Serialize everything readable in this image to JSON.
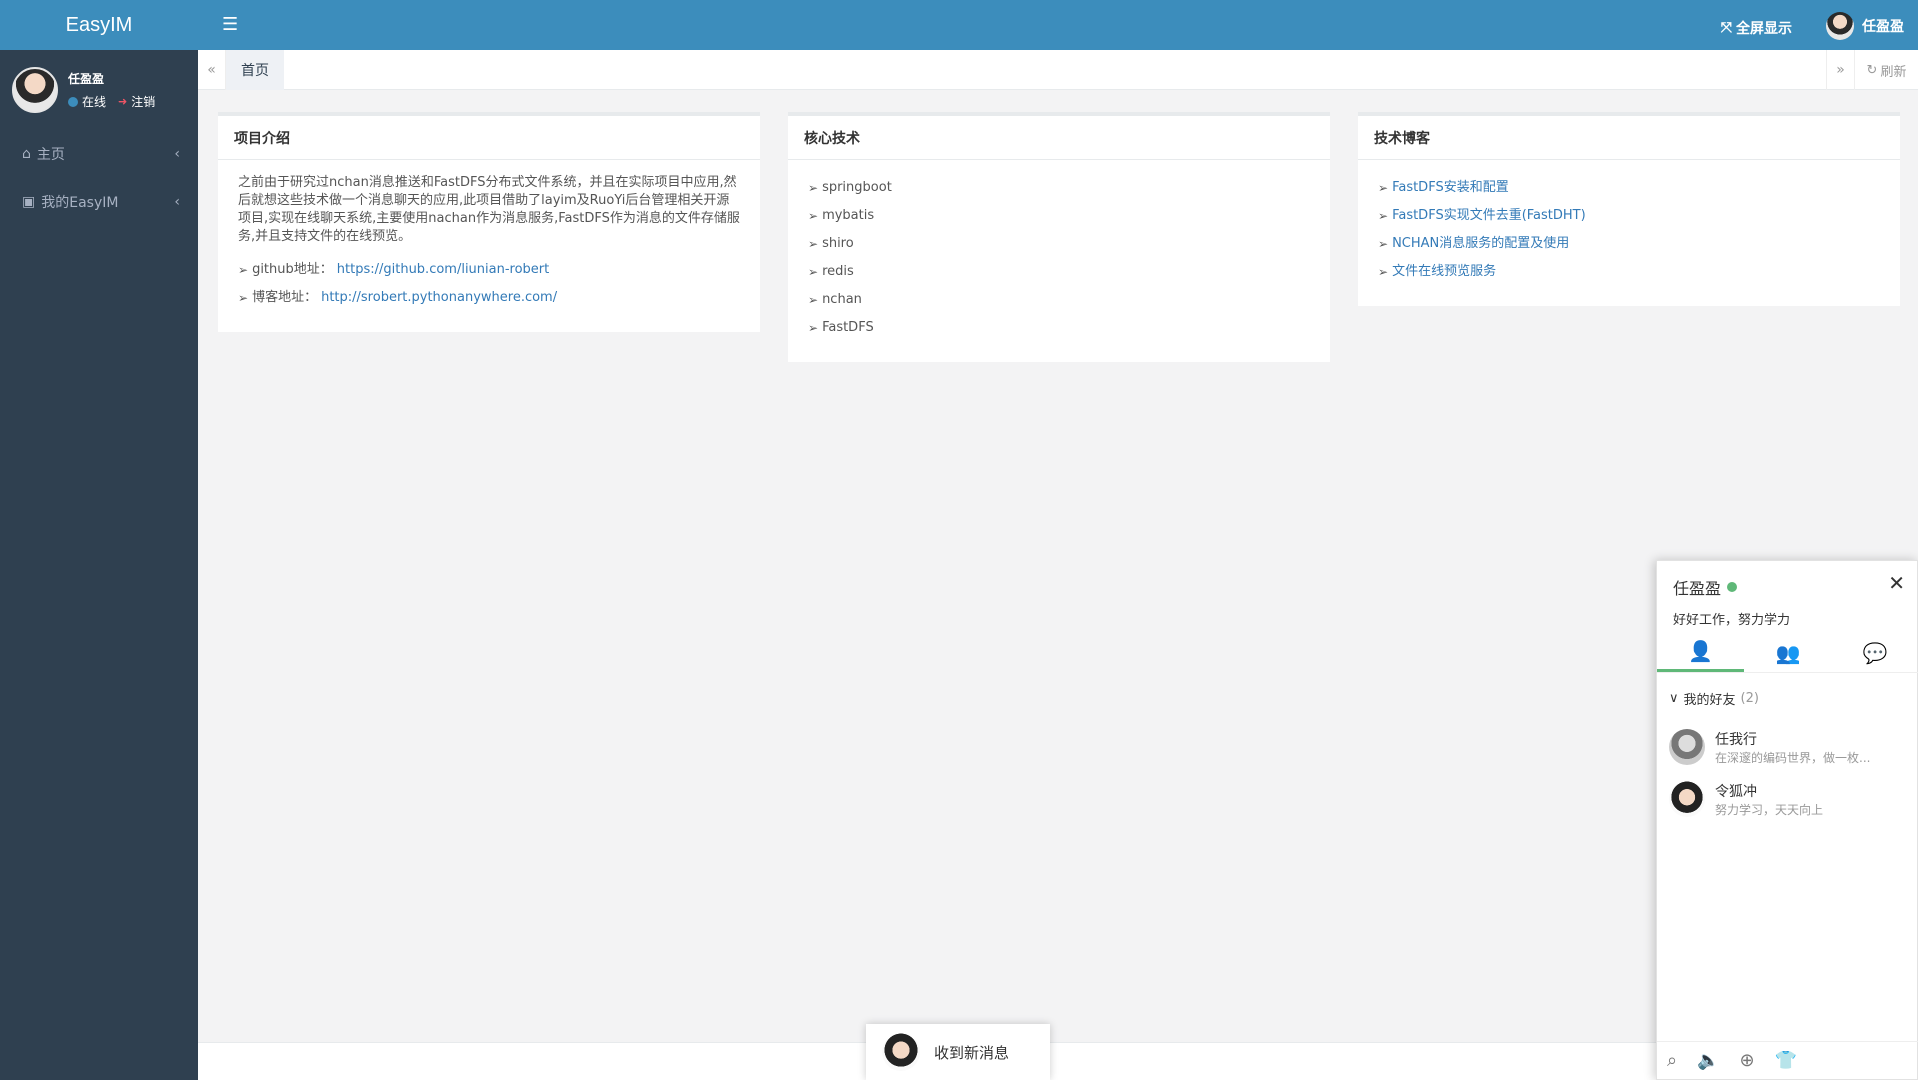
{
  "app": {
    "title": "EasyIM"
  },
  "sidebar": {
    "user": {
      "name": "任盈盈",
      "status": "在线",
      "logout": "注销"
    },
    "items": [
      {
        "label": "主页"
      },
      {
        "label": "我的EasyIM"
      }
    ]
  },
  "header": {
    "fullscreen_label": "全屏显示",
    "user_name": "任盈盈"
  },
  "tabs": {
    "home_label": "首页",
    "refresh_label": "刷新"
  },
  "panels": {
    "intro": {
      "title": "项目介绍",
      "text": "之前由于研究过nchan消息推送和FastDFS分布式文件系统，并且在实际项目中应用,然后就想这些技术做一个消息聊天的应用,此项目借助了layim及RuoYi后台管理相关开源项目,实现在线聊天系统,主要使用nachan作为消息服务,FastDFS作为消息的文件存储服务,并且支持文件的在线预览。",
      "github_label": "github地址：",
      "github_url": "https://github.com/liunian-robert",
      "blog_label": "博客地址：",
      "blog_url": "http://srobert.pythonanywhere.com/"
    },
    "tech": {
      "title": "核心技术",
      "items": [
        "springboot",
        "mybatis",
        "shiro",
        "redis",
        "nchan",
        "FastDFS"
      ]
    },
    "blog": {
      "title": "技术博客",
      "items": [
        "FastDFS安装和配置",
        "FastDFS实现文件去重(FastDHT)",
        "NCHAN消息服务的配置及使用",
        "文件在线预览服务"
      ]
    }
  },
  "toast": {
    "text": "收到新消息"
  },
  "im": {
    "name": "任盈盈",
    "sign": "好好工作，努力学力",
    "group": {
      "label": "我的好友",
      "count": "(2)"
    },
    "friends": [
      {
        "name": "任我行",
        "sign": "在深邃的编码世界，做一枚..."
      },
      {
        "name": "令狐冲",
        "sign": "努力学习，天天向上"
      }
    ]
  },
  "colors": {
    "header": "#3c8dbc",
    "sidebar": "#2f4050",
    "online": "#5FB878",
    "link": "#337ab7"
  }
}
